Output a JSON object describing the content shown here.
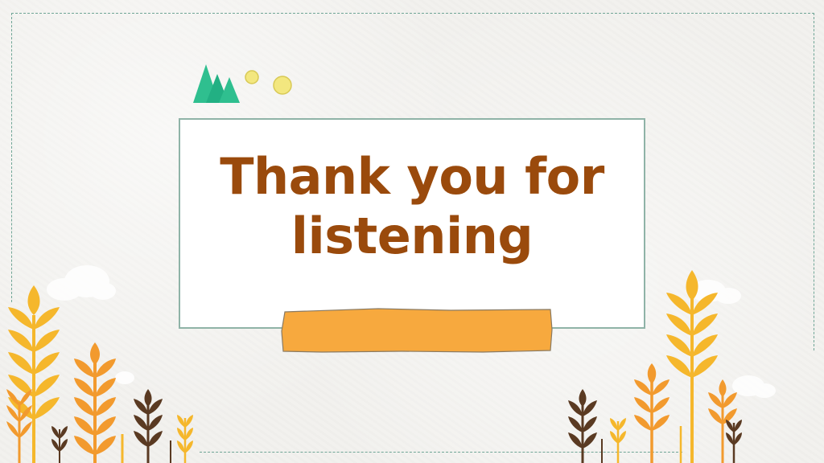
{
  "slide": {
    "title_line1": "Thank you for",
    "title_line2": "listening"
  },
  "colors": {
    "title": "#9a4a0c",
    "frame": "#8fb3a7",
    "dashed_border": "#6fa596",
    "tape": "#f7a93e",
    "tree": "#2fbf8f",
    "dot": "#f3e77f",
    "wheat_yellow": "#f5b72c",
    "wheat_orange": "#f29a2e",
    "wheat_brown": "#5a3a22"
  },
  "icons": [
    "tree-icon",
    "dot-icon",
    "wheat-icon",
    "cloud-icon"
  ]
}
